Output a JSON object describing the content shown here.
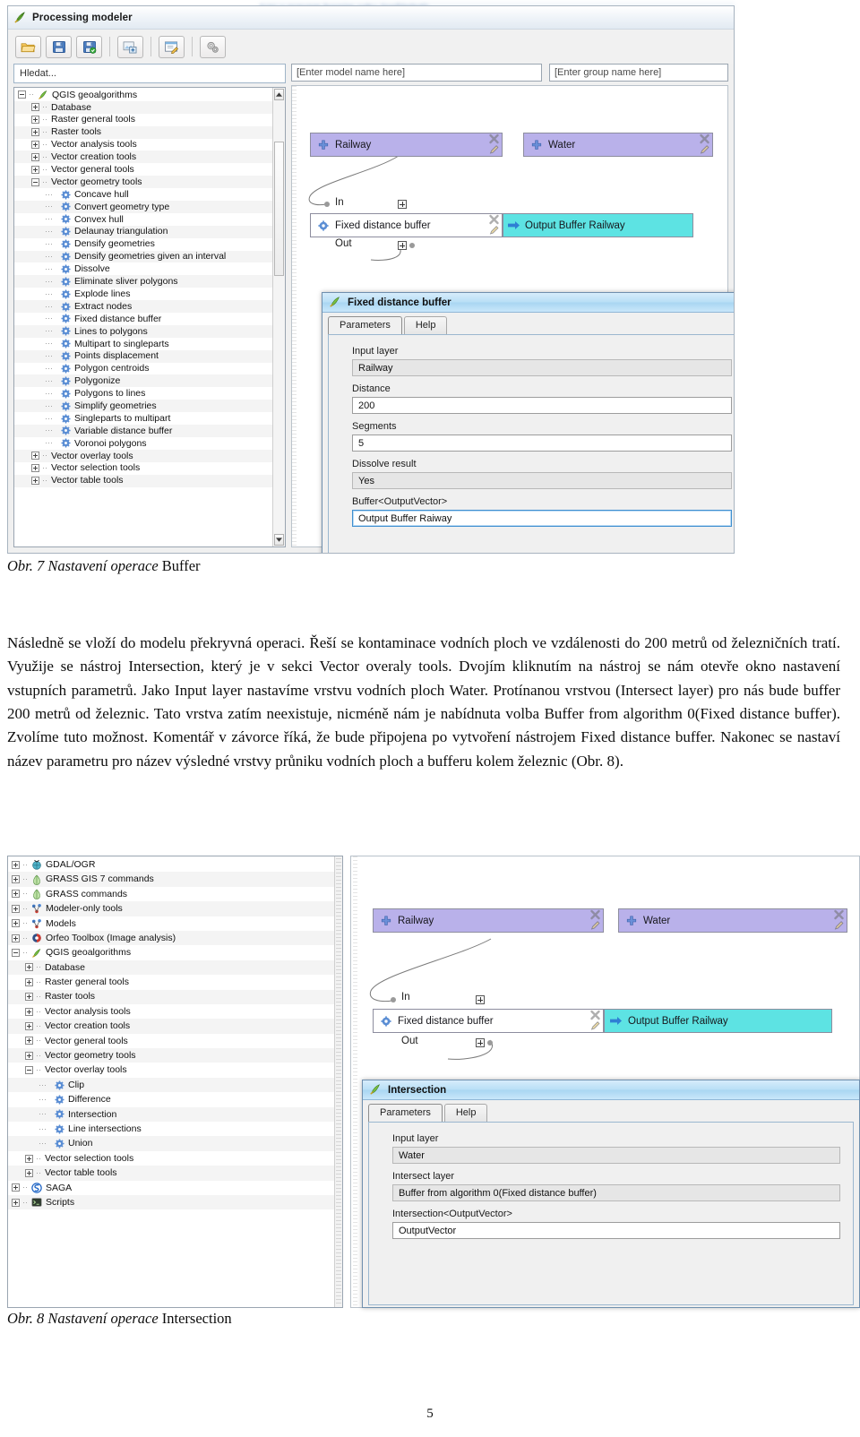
{
  "page": {
    "number": "5"
  },
  "blurred_header": "tvar v pravem hornim rohu (nečitelné)",
  "figure7": {
    "window_title": "Processing modeler",
    "toolbar": [
      {
        "name": "open-model",
        "label": "Open Model"
      },
      {
        "name": "save-model",
        "label": "Save Model"
      },
      {
        "name": "save-model-as",
        "label": "Save Model As"
      },
      {
        "name": "export-image",
        "label": "Export as Image"
      },
      {
        "name": "edit-help",
        "label": "Edit Model Help"
      },
      {
        "name": "run-model",
        "label": "Run Model"
      }
    ],
    "search_placeholder": "Hledat...",
    "tree": [
      {
        "label": "QGIS geoalgorithms",
        "depth": 0,
        "state": "minus",
        "icon": "qgis-icon"
      },
      {
        "label": "Database",
        "depth": 1,
        "state": "plus",
        "icon": "none"
      },
      {
        "label": "Raster general tools",
        "depth": 1,
        "state": "plus",
        "icon": "none"
      },
      {
        "label": "Raster tools",
        "depth": 1,
        "state": "plus",
        "icon": "none"
      },
      {
        "label": "Vector analysis tools",
        "depth": 1,
        "state": "plus",
        "icon": "none"
      },
      {
        "label": "Vector creation tools",
        "depth": 1,
        "state": "plus",
        "icon": "none"
      },
      {
        "label": "Vector general tools",
        "depth": 1,
        "state": "plus",
        "icon": "none"
      },
      {
        "label": "Vector geometry tools",
        "depth": 1,
        "state": "minus",
        "icon": "none"
      },
      {
        "label": "Concave hull",
        "depth": 2,
        "state": "leaf",
        "icon": "gear-icon"
      },
      {
        "label": "Convert geometry type",
        "depth": 2,
        "state": "leaf",
        "icon": "gear-icon"
      },
      {
        "label": "Convex hull",
        "depth": 2,
        "state": "leaf",
        "icon": "gear-icon"
      },
      {
        "label": "Delaunay triangulation",
        "depth": 2,
        "state": "leaf",
        "icon": "gear-icon"
      },
      {
        "label": "Densify geometries",
        "depth": 2,
        "state": "leaf",
        "icon": "gear-icon"
      },
      {
        "label": "Densify geometries given an interval",
        "depth": 2,
        "state": "leaf",
        "icon": "gear-icon"
      },
      {
        "label": "Dissolve",
        "depth": 2,
        "state": "leaf",
        "icon": "gear-icon"
      },
      {
        "label": "Eliminate sliver polygons",
        "depth": 2,
        "state": "leaf",
        "icon": "gear-icon"
      },
      {
        "label": "Explode lines",
        "depth": 2,
        "state": "leaf",
        "icon": "gear-icon"
      },
      {
        "label": "Extract nodes",
        "depth": 2,
        "state": "leaf",
        "icon": "gear-icon"
      },
      {
        "label": "Fixed distance buffer",
        "depth": 2,
        "state": "leaf",
        "icon": "gear-icon"
      },
      {
        "label": "Lines to polygons",
        "depth": 2,
        "state": "leaf",
        "icon": "gear-icon"
      },
      {
        "label": "Multipart to singleparts",
        "depth": 2,
        "state": "leaf",
        "icon": "gear-icon"
      },
      {
        "label": "Points displacement",
        "depth": 2,
        "state": "leaf",
        "icon": "gear-icon"
      },
      {
        "label": "Polygon centroids",
        "depth": 2,
        "state": "leaf",
        "icon": "gear-icon"
      },
      {
        "label": "Polygonize",
        "depth": 2,
        "state": "leaf",
        "icon": "gear-icon"
      },
      {
        "label": "Polygons to lines",
        "depth": 2,
        "state": "leaf",
        "icon": "gear-icon"
      },
      {
        "label": "Simplify geometries",
        "depth": 2,
        "state": "leaf",
        "icon": "gear-icon"
      },
      {
        "label": "Singleparts to multipart",
        "depth": 2,
        "state": "leaf",
        "icon": "gear-icon"
      },
      {
        "label": "Variable distance buffer",
        "depth": 2,
        "state": "leaf",
        "icon": "gear-icon"
      },
      {
        "label": "Voronoi polygons",
        "depth": 2,
        "state": "leaf",
        "icon": "gear-icon"
      },
      {
        "label": "Vector overlay tools",
        "depth": 1,
        "state": "plus",
        "icon": "none"
      },
      {
        "label": "Vector selection tools",
        "depth": 1,
        "state": "plus",
        "icon": "none"
      },
      {
        "label": "Vector table tools",
        "depth": 1,
        "state": "plus",
        "icon": "none"
      }
    ],
    "model_name_placeholder": "[Enter model name here]",
    "group_name_placeholder": "[Enter group name here]",
    "nodes": {
      "input_railway": "Railway",
      "input_water": "Water",
      "algo_buffer": "Fixed distance buffer",
      "output_buffer": "Output Buffer Railway",
      "port_in": "In",
      "port_out": "Out"
    },
    "dialog": {
      "title": "Fixed distance buffer",
      "tabs": [
        "Parameters",
        "Help"
      ],
      "fields": [
        {
          "label": "Input layer",
          "value": "Railway",
          "kind": "combo"
        },
        {
          "label": "Distance",
          "value": "200",
          "kind": "text"
        },
        {
          "label": "Segments",
          "value": "5",
          "kind": "text"
        },
        {
          "label": "Dissolve result",
          "value": "Yes",
          "kind": "combo"
        },
        {
          "label": "Buffer<OutputVector>",
          "value": "Output Buffer Raiway",
          "kind": "text-focus"
        }
      ]
    },
    "caption_prefix": "Obr. 7 Nastavení operace ",
    "caption_term": "Buffer"
  },
  "paragraph": "Následně se vloží do modelu překryvná operaci. Řeší se kontaminace vodních ploch ve vzdálenosti do 200 metrů od železničních tratí. Využije se nástroj Intersection, který je v sekci Vector overaly tools. Dvojím kliknutím na nástroj se nám otevře okno nastavení vstupních parametrů. Jako Input layer nastavíme vrstvu vodních ploch Water. Protínanou vrstvou (Intersect layer) pro nás bude buffer 200 metrů od železnic. Tato vrstva zatím neexistuje, nicméně nám je nabídnuta volba Buffer from algorithm 0(Fixed distance buffer). Zvolíme tuto možnost. Komentář v závorce říká, že bude připojena po vytvoření nástrojem Fixed distance buffer. Nakonec se nastaví název parametru pro název výsledné vrstvy průniku vodních ploch a bufferu kolem železnic (Obr. 8).",
  "figure8": {
    "tree": [
      {
        "label": "GDAL/OGR",
        "depth": 0,
        "state": "plus",
        "icon": "gdal-icon"
      },
      {
        "label": "GRASS GIS 7 commands",
        "depth": 0,
        "state": "plus",
        "icon": "grass-icon"
      },
      {
        "label": "GRASS commands",
        "depth": 0,
        "state": "plus",
        "icon": "grass-icon"
      },
      {
        "label": "Modeler-only tools",
        "depth": 0,
        "state": "plus",
        "icon": "modeler-icon"
      },
      {
        "label": "Models",
        "depth": 0,
        "state": "plus",
        "icon": "modeler-icon"
      },
      {
        "label": "Orfeo Toolbox (Image analysis)",
        "depth": 0,
        "state": "plus",
        "icon": "orfeo-icon"
      },
      {
        "label": "QGIS geoalgorithms",
        "depth": 0,
        "state": "minus",
        "icon": "qgis-icon"
      },
      {
        "label": "Database",
        "depth": 1,
        "state": "plus",
        "icon": "none"
      },
      {
        "label": "Raster general tools",
        "depth": 1,
        "state": "plus",
        "icon": "none"
      },
      {
        "label": "Raster tools",
        "depth": 1,
        "state": "plus",
        "icon": "none"
      },
      {
        "label": "Vector analysis tools",
        "depth": 1,
        "state": "plus",
        "icon": "none"
      },
      {
        "label": "Vector creation tools",
        "depth": 1,
        "state": "plus",
        "icon": "none"
      },
      {
        "label": "Vector general tools",
        "depth": 1,
        "state": "plus",
        "icon": "none"
      },
      {
        "label": "Vector geometry tools",
        "depth": 1,
        "state": "plus",
        "icon": "none"
      },
      {
        "label": "Vector overlay tools",
        "depth": 1,
        "state": "minus",
        "icon": "none"
      },
      {
        "label": "Clip",
        "depth": 2,
        "state": "leaf",
        "icon": "gear-icon"
      },
      {
        "label": "Difference",
        "depth": 2,
        "state": "leaf",
        "icon": "gear-icon"
      },
      {
        "label": "Intersection",
        "depth": 2,
        "state": "leaf",
        "icon": "gear-icon"
      },
      {
        "label": "Line intersections",
        "depth": 2,
        "state": "leaf",
        "icon": "gear-icon"
      },
      {
        "label": "Union",
        "depth": 2,
        "state": "leaf",
        "icon": "gear-icon"
      },
      {
        "label": "Vector selection tools",
        "depth": 1,
        "state": "plus",
        "icon": "none"
      },
      {
        "label": "Vector table tools",
        "depth": 1,
        "state": "plus",
        "icon": "none"
      },
      {
        "label": "SAGA",
        "depth": 0,
        "state": "plus",
        "icon": "saga-icon"
      },
      {
        "label": "Scripts",
        "depth": 0,
        "state": "plus",
        "icon": "scripts-icon"
      }
    ],
    "nodes": {
      "input_railway": "Railway",
      "input_water": "Water",
      "algo_buffer": "Fixed distance buffer",
      "output_buffer": "Output Buffer Railway",
      "port_in": "In",
      "port_out": "Out"
    },
    "dialog": {
      "title": "Intersection",
      "tabs": [
        "Parameters",
        "Help"
      ],
      "fields": [
        {
          "label": "Input layer",
          "value": "Water",
          "kind": "combo"
        },
        {
          "label": "Intersect layer",
          "value": "Buffer from algorithm 0(Fixed distance buffer)",
          "kind": "combo"
        },
        {
          "label": "Intersection<OutputVector>",
          "value": "OutputVector",
          "kind": "text"
        }
      ]
    },
    "caption_prefix": "Obr. 8 Nastavení operace ",
    "caption_term": "Intersection"
  }
}
